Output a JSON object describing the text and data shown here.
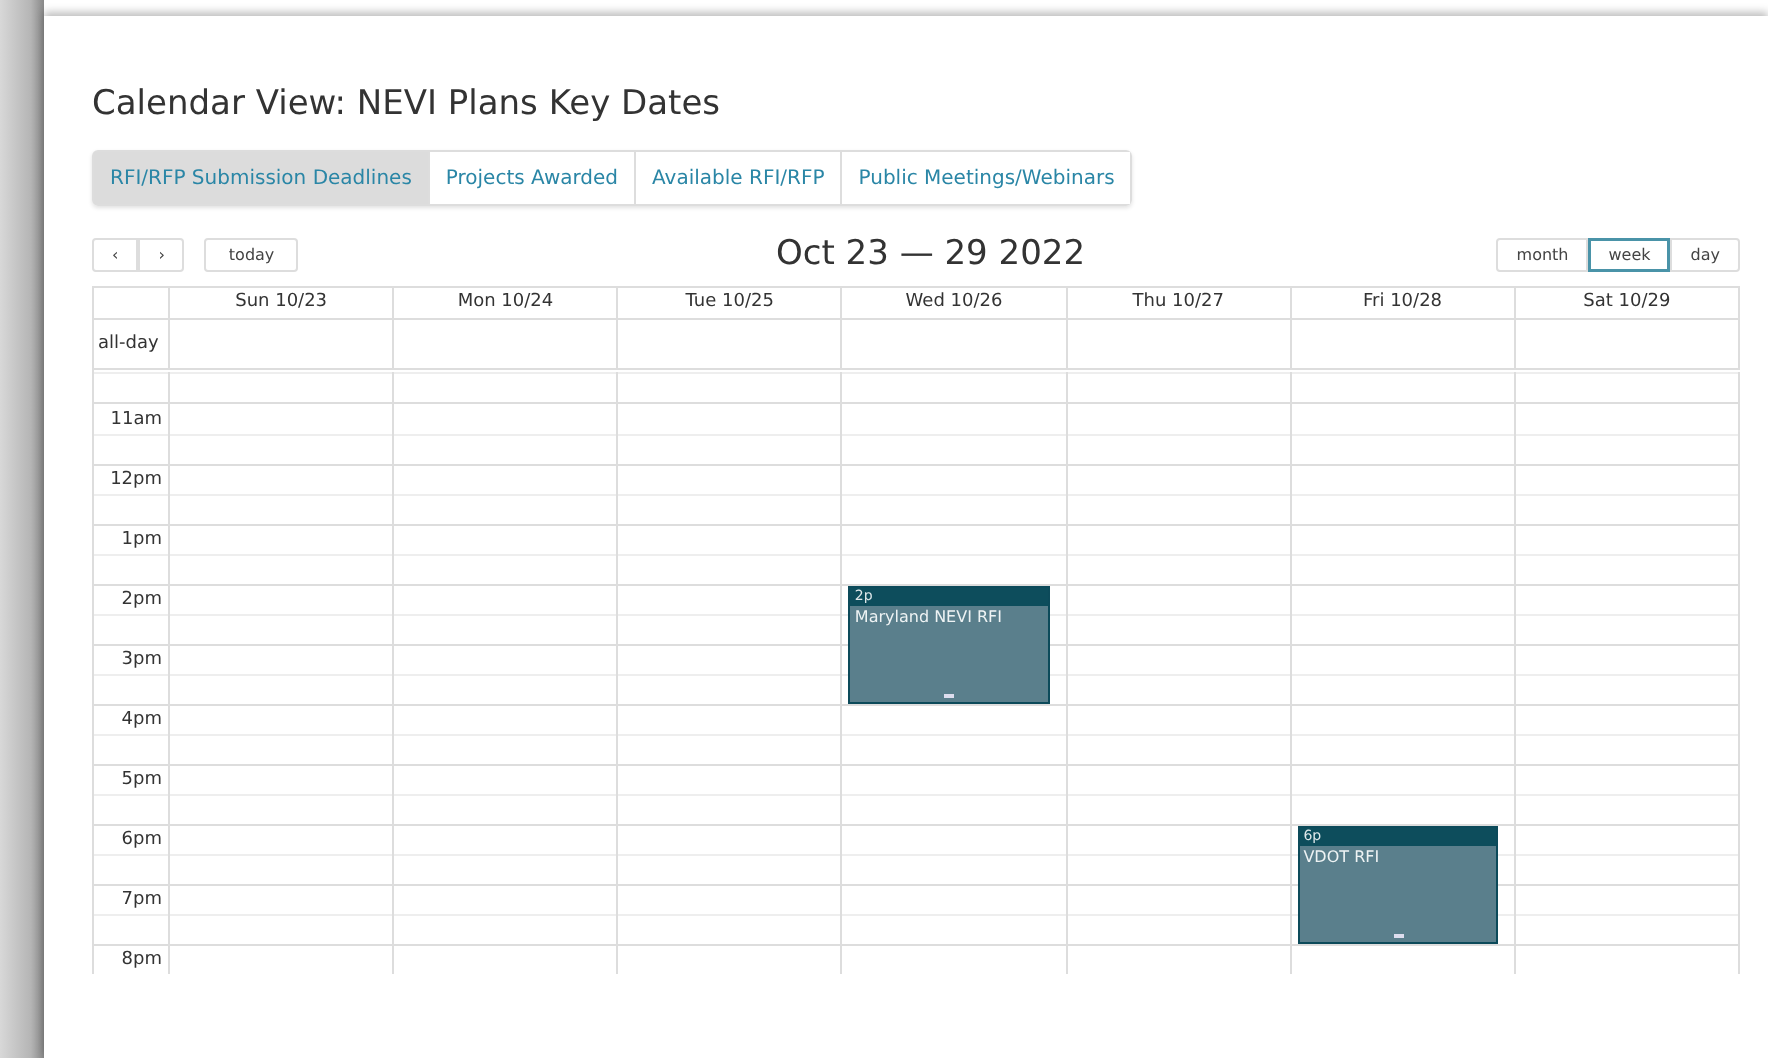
{
  "page": {
    "title": "Calendar View: NEVI Plans Key Dates"
  },
  "tabs": [
    {
      "label": "RFI/RFP Submission Deadlines",
      "selected": true
    },
    {
      "label": "Projects Awarded",
      "selected": false
    },
    {
      "label": "Available RFI/RFP",
      "selected": false
    },
    {
      "label": "Public Meetings/Webinars",
      "selected": false
    }
  ],
  "toolbar": {
    "prev": "‹",
    "next": "›",
    "today": "today",
    "range_title": "Oct 23 — 29 2022",
    "views": [
      {
        "label": "month",
        "selected": false
      },
      {
        "label": "week",
        "selected": true
      },
      {
        "label": "day",
        "selected": false
      }
    ]
  },
  "calendar": {
    "all_day_label": "all-day",
    "days": [
      {
        "label": "Sun 10/23"
      },
      {
        "label": "Mon 10/24"
      },
      {
        "label": "Tue 10/25"
      },
      {
        "label": "Wed 10/26",
        "events": [
          {
            "time": "2p",
            "title": "Maryland NEVI RFI"
          }
        ]
      },
      {
        "label": "Thu 10/27"
      },
      {
        "label": "Fri 10/28",
        "events": [
          {
            "time": "6p",
            "title": "VDOT RFI"
          }
        ]
      },
      {
        "label": "Sat 10/29"
      }
    ],
    "hours": [
      "11am",
      "12pm",
      "1pm",
      "2pm",
      "3pm",
      "4pm",
      "5pm",
      "6pm",
      "7pm",
      "8pm"
    ]
  }
}
